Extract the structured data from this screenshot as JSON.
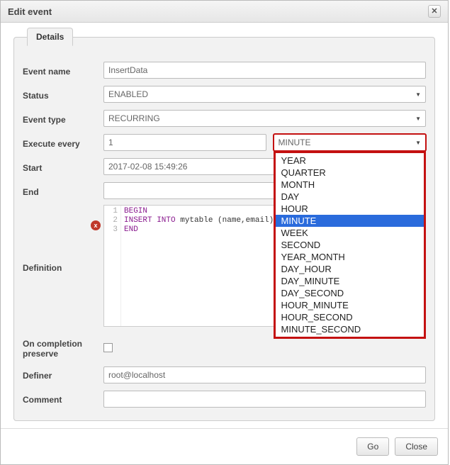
{
  "dialog": {
    "title": "Edit event",
    "close_icon": "x"
  },
  "tab": {
    "label": "Details"
  },
  "labels": {
    "event_name": "Event name",
    "status": "Status",
    "event_type": "Event type",
    "execute_every": "Execute every",
    "start": "Start",
    "end": "End",
    "definition": "Definition",
    "on_completion_preserve": "On completion preserve",
    "definer": "Definer",
    "comment": "Comment"
  },
  "values": {
    "event_name": "InsertData",
    "status": "ENABLED",
    "event_type": "RECURRING",
    "execute_every_number": "1",
    "execute_every_unit": "MINUTE",
    "start": "2017-02-08 15:49:26",
    "end": "",
    "definer": "root@localhost",
    "comment": "",
    "on_completion_preserve_checked": false
  },
  "interval_options": [
    "YEAR",
    "QUARTER",
    "MONTH",
    "DAY",
    "HOUR",
    "MINUTE",
    "WEEK",
    "SECOND",
    "YEAR_MONTH",
    "DAY_HOUR",
    "DAY_MINUTE",
    "DAY_SECOND",
    "HOUR_MINUTE",
    "HOUR_SECOND",
    "MINUTE_SECOND"
  ],
  "interval_selected": "MINUTE",
  "code": {
    "lines": [
      "1",
      "2",
      "3"
    ],
    "l1_kw": "BEGIN",
    "l2_kw": "INSERT INTO",
    "l2_rest": " mytable (name,email)",
    "l3_kw": "END",
    "error_glyph": "x"
  },
  "footer": {
    "go": "Go",
    "close": "Close"
  }
}
